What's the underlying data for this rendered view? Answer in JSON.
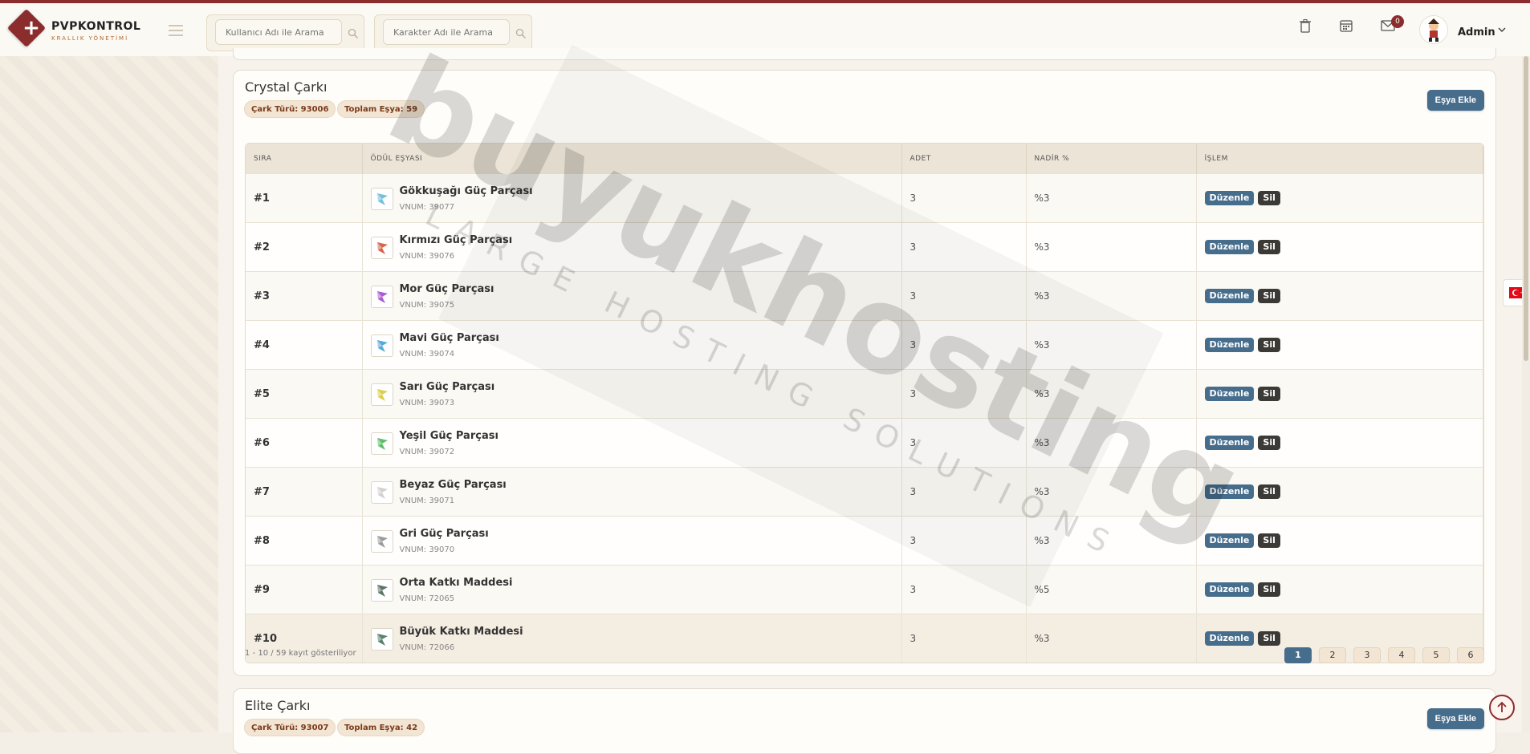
{
  "brand": {
    "title": "PVPKONTROL",
    "subtitle": "KRALLIK YÖNETİMİ"
  },
  "search": {
    "user_placeholder": "Kullanıcı Adı ile Arama",
    "character_placeholder": "Karakter Adı ile Arama"
  },
  "header": {
    "icons": [
      "trash-icon",
      "calendar-icon",
      "mail-icon"
    ],
    "mail_badge": "0",
    "user_name": "Admin"
  },
  "colors": {
    "accent": "#8b2d2d",
    "button_primary": "#476d8c",
    "button_dark": "#3b3a37"
  },
  "wheel1": {
    "title": "Crystal Çarkı",
    "type_pill": "Çark Türü: 93006",
    "count_pill": "Toplam Eşya: 59",
    "add_label": "Eşya Ekle",
    "columns": [
      "SIRA",
      "ÖDÜL EŞYASI",
      "ADET",
      "NADİR %",
      "İŞLEM"
    ],
    "rows": [
      {
        "rank": "#1",
        "name": "Gökkuşağı Güç Parçası",
        "vnum": "VNUM: 39077",
        "qty": "3",
        "rare": "%3",
        "icon_color": "#5bb4d6"
      },
      {
        "rank": "#2",
        "name": "Kırmızı Güç Parçası",
        "vnum": "VNUM: 39076",
        "qty": "3",
        "rare": "%3",
        "icon_color": "#d0492b"
      },
      {
        "rank": "#3",
        "name": "Mor Güç Parçası",
        "vnum": "VNUM: 39075",
        "qty": "3",
        "rare": "%3",
        "icon_color": "#9b3cc8"
      },
      {
        "rank": "#4",
        "name": "Mavi Güç Parçası",
        "vnum": "VNUM: 39074",
        "qty": "3",
        "rare": "%3",
        "icon_color": "#3a9ad0"
      },
      {
        "rank": "#5",
        "name": "Sarı Güç Parçası",
        "vnum": "VNUM: 39073",
        "qty": "3",
        "rare": "%3",
        "icon_color": "#d6c42a"
      },
      {
        "rank": "#6",
        "name": "Yeşil Güç Parçası",
        "vnum": "VNUM: 39072",
        "qty": "3",
        "rare": "%3",
        "icon_color": "#3fb34c"
      },
      {
        "rank": "#7",
        "name": "Beyaz Güç Parçası",
        "vnum": "VNUM: 39071",
        "qty": "3",
        "rare": "%3",
        "icon_color": "#c9c9c9"
      },
      {
        "rank": "#8",
        "name": "Gri Güç Parçası",
        "vnum": "VNUM: 39070",
        "qty": "3",
        "rare": "%3",
        "icon_color": "#8a8a8a"
      },
      {
        "rank": "#9",
        "name": "Orta Katkı Maddesi",
        "vnum": "VNUM: 72065",
        "qty": "3",
        "rare": "%5",
        "icon_color": "#3f5d4a"
      },
      {
        "rank": "#10",
        "name": "Büyük Katkı Maddesi",
        "vnum": "VNUM: 72066",
        "qty": "3",
        "rare": "%3",
        "icon_color": "#3d6b52"
      }
    ],
    "edit_label": "Düzenle",
    "delete_label": "Sil",
    "info": "1 - 10 / 59 kayıt gösteriliyor",
    "pages": [
      "1",
      "2",
      "3",
      "4",
      "5",
      "6"
    ],
    "active_page": "1"
  },
  "wheel2": {
    "title": "Elite Çarkı",
    "type_pill": "Çark Türü: 93007",
    "count_pill": "Toplam Eşya: 42",
    "add_label": "Eşya Ekle"
  },
  "watermark": {
    "main": "buyukhosting",
    "sub": "LARGE HOSTING SOLUTIONS"
  }
}
